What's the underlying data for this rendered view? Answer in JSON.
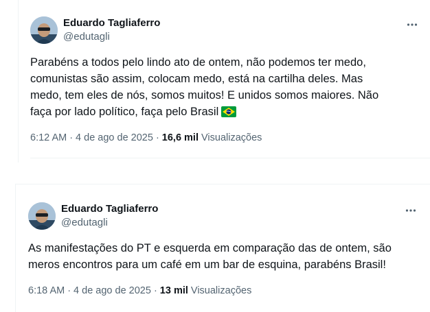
{
  "tweets": [
    {
      "author_name": "Eduardo Tagliaferro",
      "author_handle": "@edutagli",
      "body_lines": [
        "Parabéns a todos pelo lindo ato de ontem, não podemos ter medo,",
        "comunistas são assim, colocam medo, está na cartilha deles. Mas",
        "medo, tem eles de nós, somos muitos! E unidos somos maiores. Não",
        "faça  por lado político, faça pelo Brasil"
      ],
      "emoji": "brazil-flag",
      "time": "6:12 AM",
      "date": "4 de ago de 2025",
      "views_count": "16,6 mil",
      "views_label": "Visualizações"
    },
    {
      "author_name": "Eduardo Tagliaferro",
      "author_handle": "@edutagli",
      "body_lines": [
        "As manifestações do PT e esquerda em comparação das de ontem, são",
        "meros encontros para um café em um bar de esquina, parabéns Brasil!"
      ],
      "time": "6:18 AM",
      "date": "4 de ago de 2025",
      "views_count": "13 mil",
      "views_label": "Visualizações"
    }
  ],
  "separator": "·",
  "icons": {
    "more": "more-horizontal-icon",
    "avatar": "avatar-photo",
    "flag": "brazil-flag-emoji"
  },
  "colors": {
    "text_primary": "#0f1419",
    "text_secondary": "#536471",
    "border": "#eff3f4"
  }
}
